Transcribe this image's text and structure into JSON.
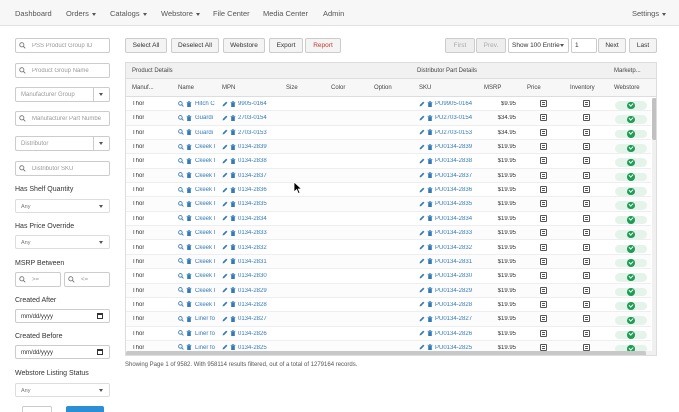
{
  "nav": {
    "dashboard": "Dashboard",
    "orders": "Orders",
    "catalogs": "Catalogs",
    "webstore": "Webstore",
    "file_center": "File Center",
    "media_center": "Media Center",
    "admin": "Admin",
    "settings": "Settings"
  },
  "filters": {
    "pss_group_id_placeholder": "PSS Product Group ID",
    "group_name_placeholder": "Product Group Name",
    "manufacturer_group_placeholder": "Manufacturer Group",
    "manufacturer_part_placeholder": "Manufacturer Part Numbe",
    "distributor_placeholder": "Distributor",
    "distributor_sku_placeholder": "Distributor SKU",
    "shelf_quantity_label": "Has Shelf Quantity",
    "shelf_quantity_value": "Any",
    "price_override_label": "Has Price Override",
    "price_override_value": "Any",
    "msrp_between_label": "MSRP Between",
    "msrp_min_placeholder": ">=",
    "msrp_max_placeholder": "<=",
    "created_after_label": "Created After",
    "created_after_placeholder": "mm/dd/yyyy",
    "created_before_label": "Created Before",
    "created_before_placeholder": "mm/dd/yyyy",
    "webstore_status_label": "Webstore Listing Status",
    "webstore_status_value": "Any"
  },
  "toolbar": {
    "select_all": "Select All",
    "deselect_all": "Deselect All",
    "webstore": "Webstore",
    "export": "Export",
    "report": "Report",
    "first": "First",
    "prev": "Prev.",
    "page_size": "Show 100 Entrie",
    "page_number": "1",
    "next": "Next",
    "last": "Last"
  },
  "table": {
    "group_headers": {
      "product_details": "Product Details",
      "distributor_details": "Distributor Part Details",
      "marketplace": "Marketp..."
    },
    "columns": {
      "manufacturer": "Manuf...",
      "name": "Name",
      "mpn": "MPN",
      "size": "Size",
      "color": "Color",
      "option": "Option",
      "sku": "SKU",
      "msrp": "MSRP",
      "price": "Price",
      "inventory": "Inventory",
      "webstore": "Webstore"
    },
    "rows": [
      {
        "manufacturer": "Thor",
        "name": "Hitch C",
        "mpn": "9905-0164",
        "sku": "PU9905-0164",
        "msrp": "$9.95"
      },
      {
        "manufacturer": "Thor",
        "name": "Guardi",
        "mpn": "2703-0154",
        "sku": "PU2703-0154",
        "msrp": "$34.95"
      },
      {
        "manufacturer": "Thor",
        "name": "Guardi",
        "mpn": "2703-0153",
        "sku": "PU2703-0153",
        "msrp": "$34.95"
      },
      {
        "manufacturer": "Thor",
        "name": "Ckeek I",
        "mpn": "0134-2839",
        "sku": "PU0134-2839",
        "msrp": "$19.95"
      },
      {
        "manufacturer": "Thor",
        "name": "Ckeek I",
        "mpn": "0134-2838",
        "sku": "PU0134-2838",
        "msrp": "$19.95"
      },
      {
        "manufacturer": "Thor",
        "name": "Ckeek I",
        "mpn": "0134-2837",
        "sku": "PU0134-2837",
        "msrp": "$19.95"
      },
      {
        "manufacturer": "Thor",
        "name": "Ckeek I",
        "mpn": "0134-2836",
        "sku": "PU0134-2836",
        "msrp": "$19.95"
      },
      {
        "manufacturer": "Thor",
        "name": "Ckeek I",
        "mpn": "0134-2835",
        "sku": "PU0134-2835",
        "msrp": "$19.95"
      },
      {
        "manufacturer": "Thor",
        "name": "Ckeek I",
        "mpn": "0134-2834",
        "sku": "PU0134-2834",
        "msrp": "$19.95"
      },
      {
        "manufacturer": "Thor",
        "name": "Ckeek I",
        "mpn": "0134-2833",
        "sku": "PU0134-2833",
        "msrp": "$19.95"
      },
      {
        "manufacturer": "Thor",
        "name": "Ckeek I",
        "mpn": "0134-2832",
        "sku": "PU0134-2832",
        "msrp": "$19.95"
      },
      {
        "manufacturer": "Thor",
        "name": "Ckeek I",
        "mpn": "0134-2831",
        "sku": "PU0134-2831",
        "msrp": "$19.95"
      },
      {
        "manufacturer": "Thor",
        "name": "Ckeek I",
        "mpn": "0134-2830",
        "sku": "PU0134-2830",
        "msrp": "$19.95"
      },
      {
        "manufacturer": "Thor",
        "name": "Ckeek I",
        "mpn": "0134-2829",
        "sku": "PU0134-2829",
        "msrp": "$19.95"
      },
      {
        "manufacturer": "Thor",
        "name": "Ckeek I",
        "mpn": "0134-2828",
        "sku": "PU0134-2828",
        "msrp": "$19.95"
      },
      {
        "manufacturer": "Thor",
        "name": "Liner fo",
        "mpn": "0134-2827",
        "sku": "PU0134-2827",
        "msrp": "$19.95"
      },
      {
        "manufacturer": "Thor",
        "name": "Liner fo",
        "mpn": "0134-2826",
        "sku": "PU0134-2826",
        "msrp": "$19.95"
      },
      {
        "manufacturer": "Thor",
        "name": "Liner fo",
        "mpn": "0134-2825",
        "sku": "PU0134-2825",
        "msrp": "$19.95"
      }
    ]
  },
  "status_text": "Showing Page 1 of 9582. With 958114 results filtered, out of a total of 1279164 records.",
  "colors": {
    "link": "#337ab7",
    "report_red": "#c0392b",
    "webstore_active_green": "#1e9e55",
    "nav_background": "#f7f7f7"
  },
  "icons": {
    "search": "search-icon",
    "delete": "trash-icon",
    "edit": "pencil-icon",
    "calculator": "calculator-icon",
    "check": "check-circle-icon",
    "calendar": "calendar-icon"
  }
}
